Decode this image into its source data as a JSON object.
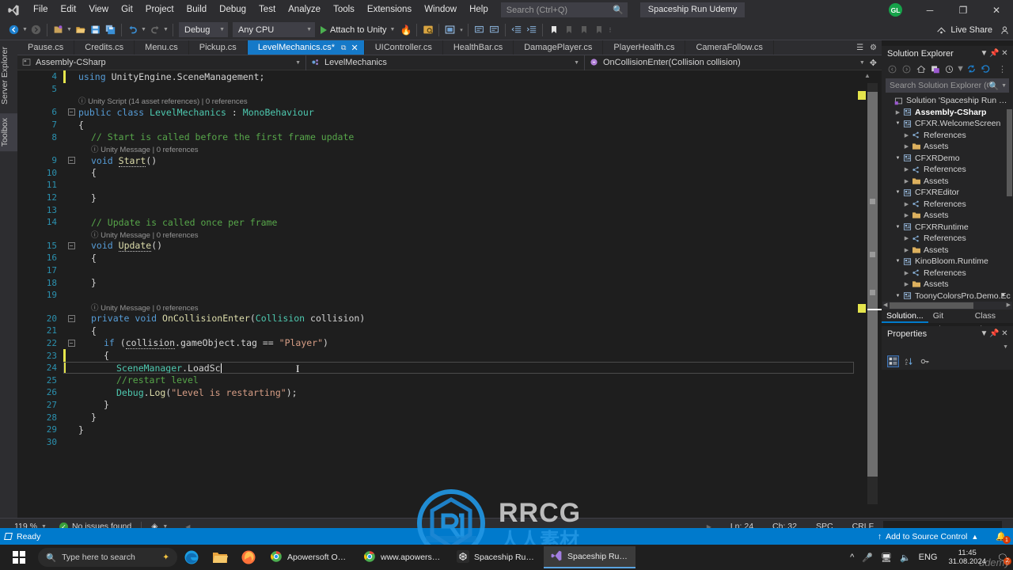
{
  "titlebar": {
    "menu": [
      "File",
      "Edit",
      "View",
      "Git",
      "Project",
      "Build",
      "Debug",
      "Test",
      "Analyze",
      "Tools",
      "Extensions",
      "Window",
      "Help"
    ],
    "search_placeholder": "Search (Ctrl+Q)",
    "project_title": "Spaceship Run Udemy",
    "avatar_initials": "GL",
    "minimize": "─",
    "restore": "❐",
    "close": "✕"
  },
  "toolbar": {
    "config": "Debug",
    "platform": "Any CPU",
    "run_label": "Attach to Unity",
    "live_share": "Live Share"
  },
  "leftdock": {
    "server_explorer": "Server Explorer",
    "toolbox": "Toolbox"
  },
  "tabs": [
    {
      "label": "Pause.cs",
      "active": false
    },
    {
      "label": "Credits.cs",
      "active": false
    },
    {
      "label": "Menu.cs",
      "active": false
    },
    {
      "label": "Pickup.cs",
      "active": false
    },
    {
      "label": "LevelMechanics.cs*",
      "active": true
    },
    {
      "label": "UIController.cs",
      "active": false
    },
    {
      "label": "HealthBar.cs",
      "active": false
    },
    {
      "label": "DamagePlayer.cs",
      "active": false
    },
    {
      "label": "PlayerHealth.cs",
      "active": false
    },
    {
      "label": "CameraFollow.cs",
      "active": false
    }
  ],
  "navbar": {
    "project": "Assembly-CSharp",
    "class": "LevelMechanics",
    "member": "OnCollisionEnter(Collision collision)"
  },
  "code": {
    "lines": [
      {
        "num": "4",
        "fold": "",
        "change": "yellow",
        "ann": "",
        "text_html": "<span class=\"kw\">using</span> <span class=\"pl\">UnityEngine</span>.<span class=\"pl\">SceneManagement</span>;",
        "indent": 0
      },
      {
        "num": "5",
        "fold": "",
        "change": "",
        "ann": "",
        "text_html": "",
        "indent": 0
      },
      {
        "num": "6",
        "fold": "minus",
        "change": "",
        "ann": "Unity Script (14 asset references) | 0 references",
        "text_html": "<span class=\"kw\">public</span> <span class=\"kw\">class</span> <span class=\"typ\">LevelMechanics</span> : <span class=\"typ\">MonoBehaviour</span>",
        "indent": 0
      },
      {
        "num": "7",
        "fold": "",
        "change": "",
        "ann": "",
        "text_html": "{",
        "indent": 0
      },
      {
        "num": "8",
        "fold": "",
        "change": "",
        "ann": "",
        "text_html": "<span class=\"cmt\">// Start is called before the first frame update</span>",
        "indent": 1
      },
      {
        "num": "9",
        "fold": "minus",
        "change": "",
        "ann": "Unity Message | 0 references",
        "text_html": "<span class=\"kw\">void</span> <span class=\"mth underline-sq\">Start</span>()",
        "indent": 1
      },
      {
        "num": "10",
        "fold": "",
        "change": "",
        "ann": "",
        "text_html": "{",
        "indent": 1
      },
      {
        "num": "11",
        "fold": "",
        "change": "",
        "ann": "",
        "text_html": "",
        "indent": 1
      },
      {
        "num": "12",
        "fold": "",
        "change": "",
        "ann": "",
        "text_html": "}",
        "indent": 1
      },
      {
        "num": "13",
        "fold": "",
        "change": "",
        "ann": "",
        "text_html": "",
        "indent": 1
      },
      {
        "num": "14",
        "fold": "",
        "change": "",
        "ann": "",
        "text_html": "<span class=\"cmt\">// Update is called once per frame</span>",
        "indent": 1
      },
      {
        "num": "15",
        "fold": "minus",
        "change": "",
        "ann": "Unity Message | 0 references",
        "text_html": "<span class=\"kw\">void</span> <span class=\"mth underline-sq\">Update</span>()",
        "indent": 1
      },
      {
        "num": "16",
        "fold": "",
        "change": "",
        "ann": "",
        "text_html": "{",
        "indent": 1
      },
      {
        "num": "17",
        "fold": "",
        "change": "",
        "ann": "",
        "text_html": "",
        "indent": 1
      },
      {
        "num": "18",
        "fold": "",
        "change": "",
        "ann": "",
        "text_html": "}",
        "indent": 1
      },
      {
        "num": "19",
        "fold": "",
        "change": "",
        "ann": "",
        "text_html": "",
        "indent": 1
      },
      {
        "num": "20",
        "fold": "minus",
        "change": "",
        "ann": "Unity Message | 0 references",
        "text_html": "<span class=\"kw\">private</span> <span class=\"kw\">void</span> <span class=\"mth\">OnCollisionEnter</span>(<span class=\"typ\">Collision</span> <span class=\"pl\">collision</span>)",
        "indent": 1
      },
      {
        "num": "21",
        "fold": "",
        "change": "",
        "ann": "",
        "text_html": "{",
        "indent": 1
      },
      {
        "num": "22",
        "fold": "minus",
        "change": "",
        "ann": "",
        "text_html": "<span class=\"kw\">if</span> (<span class=\"pl underline-sq\">collision</span>.<span class=\"pl\">gameObject</span>.<span class=\"pl\">tag</span> == <span class=\"str\">\"Player\"</span>)",
        "indent": 2
      },
      {
        "num": "23",
        "fold": "",
        "change": "yellow",
        "ann": "",
        "text_html": "{",
        "indent": 2
      },
      {
        "num": "24",
        "fold": "",
        "change": "yellow",
        "ann": "",
        "text_html": "<span class=\"typ\">SceneManager</span>.<span class=\"pl\">LoadSc</span>",
        "indent": 3,
        "current": true
      },
      {
        "num": "25",
        "fold": "",
        "change": "",
        "ann": "",
        "text_html": "<span class=\"cmt\">//restart level</span>",
        "indent": 3
      },
      {
        "num": "26",
        "fold": "",
        "change": "",
        "ann": "",
        "text_html": "<span class=\"typ\">Debug</span>.<span class=\"mth\">Log</span>(<span class=\"str\">\"Level is restarting\"</span>);",
        "indent": 3
      },
      {
        "num": "27",
        "fold": "",
        "change": "",
        "ann": "",
        "text_html": "}",
        "indent": 2
      },
      {
        "num": "28",
        "fold": "",
        "change": "",
        "ann": "",
        "text_html": "}",
        "indent": 1
      },
      {
        "num": "29",
        "fold": "",
        "change": "",
        "ann": "",
        "text_html": "}",
        "indent": 0
      },
      {
        "num": "30",
        "fold": "",
        "change": "",
        "ann": "",
        "text_html": "",
        "indent": 0
      }
    ]
  },
  "solution_explorer": {
    "title": "Solution Explorer",
    "search_placeholder": "Search Solution Explorer (Ctrl+;",
    "tree": [
      {
        "depth": 0,
        "arrow": "",
        "icon": "solution",
        "label": "Solution 'Spaceship Run Ude",
        "bold": false
      },
      {
        "depth": 1,
        "arrow": "right",
        "icon": "project",
        "label": "Assembly-CSharp",
        "bold": true
      },
      {
        "depth": 1,
        "arrow": "down",
        "icon": "project",
        "label": "CFXR.WelcomeScreen",
        "bold": false
      },
      {
        "depth": 2,
        "arrow": "right",
        "icon": "references",
        "label": "References",
        "bold": false
      },
      {
        "depth": 2,
        "arrow": "right",
        "icon": "folder",
        "label": "Assets",
        "bold": false
      },
      {
        "depth": 1,
        "arrow": "down",
        "icon": "project",
        "label": "CFXRDemo",
        "bold": false
      },
      {
        "depth": 2,
        "arrow": "right",
        "icon": "references",
        "label": "References",
        "bold": false
      },
      {
        "depth": 2,
        "arrow": "right",
        "icon": "folder",
        "label": "Assets",
        "bold": false
      },
      {
        "depth": 1,
        "arrow": "down",
        "icon": "project",
        "label": "CFXREditor",
        "bold": false
      },
      {
        "depth": 2,
        "arrow": "right",
        "icon": "references",
        "label": "References",
        "bold": false
      },
      {
        "depth": 2,
        "arrow": "right",
        "icon": "folder",
        "label": "Assets",
        "bold": false
      },
      {
        "depth": 1,
        "arrow": "down",
        "icon": "project",
        "label": "CFXRRuntime",
        "bold": false
      },
      {
        "depth": 2,
        "arrow": "right",
        "icon": "references",
        "label": "References",
        "bold": false
      },
      {
        "depth": 2,
        "arrow": "right",
        "icon": "folder",
        "label": "Assets",
        "bold": false
      },
      {
        "depth": 1,
        "arrow": "down",
        "icon": "project",
        "label": "KinoBloom.Runtime",
        "bold": false
      },
      {
        "depth": 2,
        "arrow": "right",
        "icon": "references",
        "label": "References",
        "bold": false
      },
      {
        "depth": 2,
        "arrow": "right",
        "icon": "folder",
        "label": "Assets",
        "bold": false
      },
      {
        "depth": 1,
        "arrow": "down",
        "icon": "project",
        "label": "ToonyColorsPro.Demo.Ec",
        "bold": false
      }
    ],
    "bottom_tabs": [
      {
        "label": "Solution...",
        "selected": true
      },
      {
        "label": "Git Chan...",
        "selected": false
      },
      {
        "label": "Class View",
        "selected": false
      }
    ]
  },
  "properties": {
    "title": "Properties"
  },
  "editor_status": {
    "zoom": "119 %",
    "issues": "No issues found",
    "line": "Ln: 24",
    "col": "Ch: 32",
    "spaces": "SPC",
    "eol": "CRLF"
  },
  "vs_status": {
    "ready": "Ready",
    "source_control": "Add to Source Control",
    "notification_count": "1"
  },
  "taskbar": {
    "search_placeholder": "Type here to search",
    "windows": [
      {
        "label": "Apowersoft Online ...",
        "active": false,
        "icon": "chrome"
      },
      {
        "label": "www.apowersoft.c...",
        "active": false,
        "icon": "chrome"
      },
      {
        "label": "Spaceship Run Ude...",
        "active": false,
        "icon": "unity"
      },
      {
        "label": "Spaceship Run Ude...",
        "active": true,
        "icon": "vs"
      }
    ],
    "language": "ENG",
    "time": "11:45",
    "date": "31.08.2024",
    "tray_badge": "2"
  },
  "watermark": {
    "text": "RRCG",
    "cn": "人人素材",
    "brand": "udemy"
  },
  "colors": {
    "accent": "#007acc",
    "tab_active": "#1579c8",
    "chrome": "#2d2d30",
    "editor_bg": "#1e1e1e",
    "change_marker": "#e5e54c"
  }
}
